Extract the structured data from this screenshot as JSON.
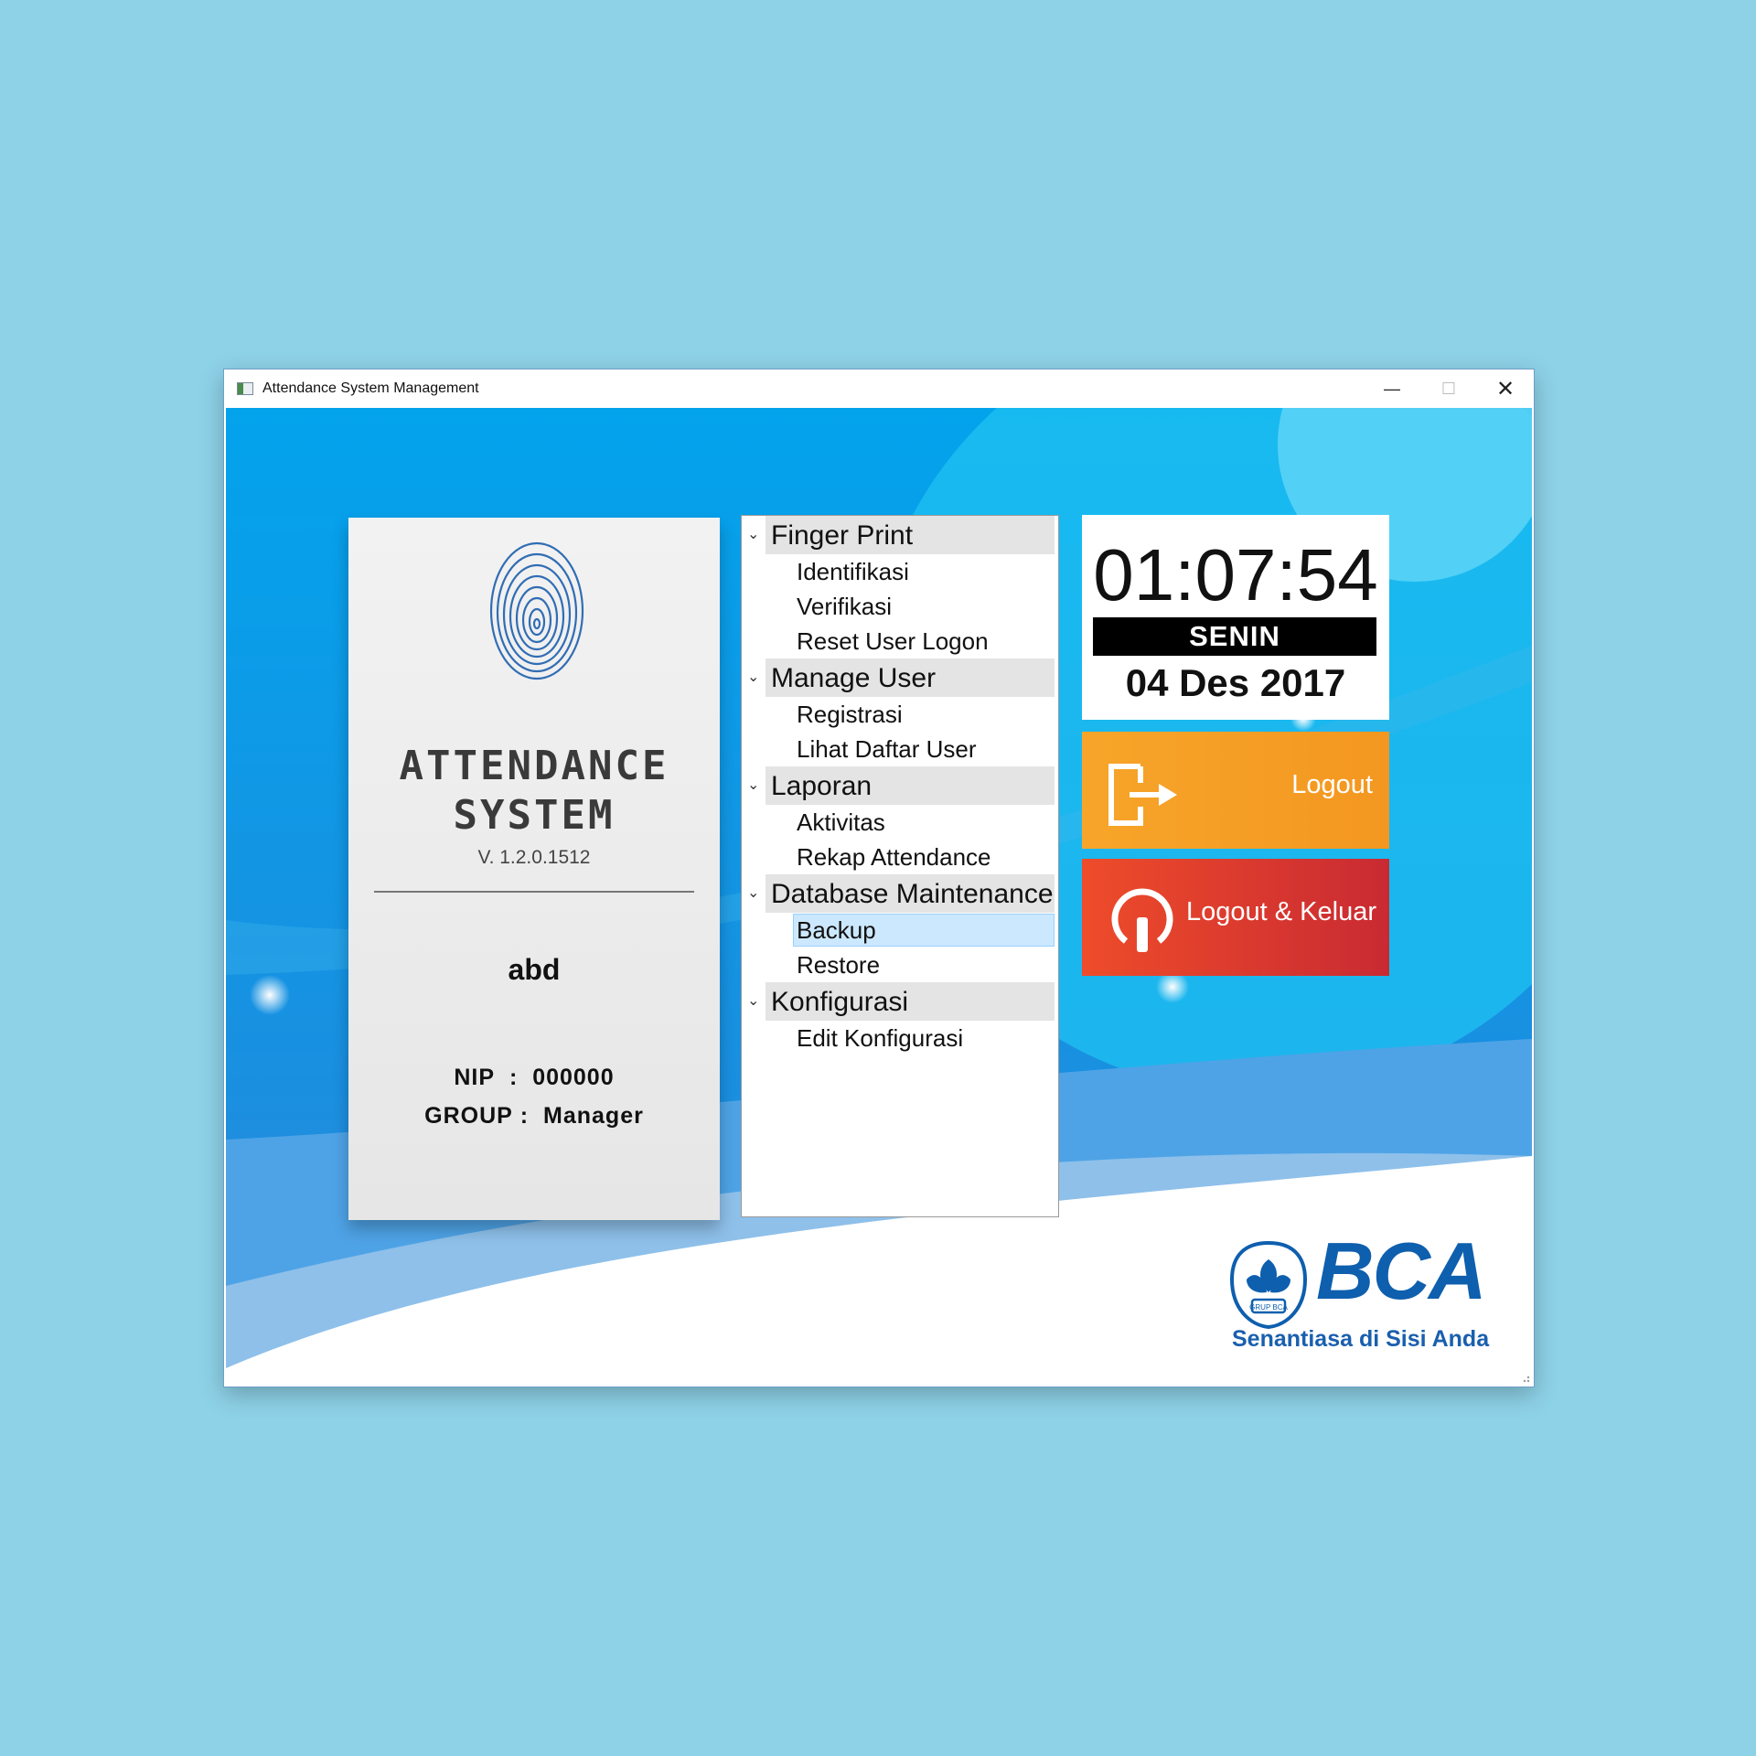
{
  "window": {
    "title": "Attendance System Management"
  },
  "card": {
    "title_line1": "ATTENDANCE",
    "title_line2": "SYSTEM",
    "version": "V. 1.2.0.1512",
    "user_name": "abd",
    "nip_label": "NIP",
    "nip_sep": ":",
    "nip_value": "000000",
    "group_label": "GROUP",
    "group_sep": ":",
    "group_value": "Manager"
  },
  "menu": [
    {
      "label": "Finger Print",
      "items": [
        "Identifikasi",
        "Verifikasi",
        "Reset User Logon"
      ]
    },
    {
      "label": "Manage User",
      "items": [
        "Registrasi",
        "Lihat Daftar User"
      ]
    },
    {
      "label": "Laporan",
      "items": [
        "Aktivitas",
        "Rekap Attendance"
      ]
    },
    {
      "label": "Database Maintenance",
      "items": [
        "Backup",
        "Restore"
      ]
    },
    {
      "label": "Konfigurasi",
      "items": [
        "Edit Konfigurasi"
      ]
    }
  ],
  "selected_item": "Backup",
  "clock": {
    "time": "01:07:54",
    "day": "SENIN",
    "date": "04 Des 2017"
  },
  "buttons": {
    "logout": "Logout",
    "logout_exit": "Logout & Keluar"
  },
  "branding": {
    "logo_text": "BCA",
    "emblem_text": "GRUP BCA",
    "tagline": "Senantiasa di Sisi Anda"
  },
  "colors": {
    "background": "#8ed2e8",
    "app_blue": "#0fa6e6",
    "logout": "#f7a52a",
    "logout_exit": "#d8342c",
    "brand": "#0e5fae"
  },
  "icons": {
    "logout": "logout-door-arrow-icon",
    "logout_exit": "power-icon",
    "chevron": "chevron-down-icon"
  }
}
